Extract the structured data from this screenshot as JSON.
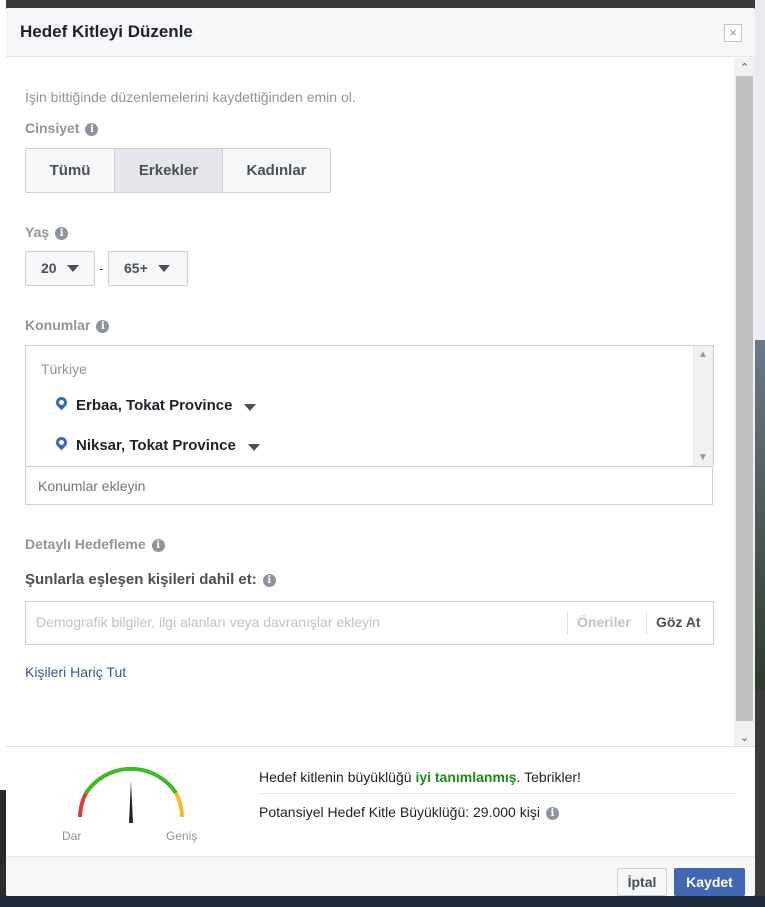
{
  "modal": {
    "title": "Hedef Kitleyi Düzenle",
    "close_icon": "×"
  },
  "hint": "İşin bittiğinde düzenlemelerini kaydettiğinden emin ol.",
  "gender": {
    "label": "Cinsiyet",
    "options": [
      "Tümü",
      "Erkekler",
      "Kadınlar"
    ],
    "selected": "Erkekler"
  },
  "age": {
    "label": "Yaş",
    "min": "20",
    "max": "65+",
    "separator": "-"
  },
  "locations": {
    "label": "Konumlar",
    "country": "Türkiye",
    "items": [
      "Erbaa, Tokat Province",
      "Niksar, Tokat Province"
    ],
    "input_placeholder": "Konumlar ekleyin"
  },
  "detailed_targeting": {
    "label": "Detaylı Hedefleme",
    "include_label": "Şunlarla eşleşen kişileri dahil et:",
    "input_placeholder": "Demografik bilgiler, ilgi alanları veya davranışlar ekleyin",
    "suggestions_label": "Öneriler",
    "browse_label": "Göz At",
    "exclude_link": "Kişileri Hariç Tut"
  },
  "audience": {
    "gauge_low": "Dar",
    "gauge_high": "Geniş",
    "gauge_level": 0.5,
    "message_prefix": "Hedef kitlenin büyüklüğü ",
    "message_status": "iyi tanımlanmış",
    "message_suffix": ". Tebrikler!",
    "size_text": "Potansiyel Hedef Kitle Büyüklüğü: 29.000 kişi",
    "status_color": "#1e8a1e"
  },
  "footer": {
    "cancel_label": "İptal",
    "save_label": "Kaydet"
  },
  "colors": {
    "primary": "#4267b2",
    "link": "#365899",
    "gauge_red": "#e0393e",
    "gauge_green": "#42b72a",
    "gauge_orange": "#f7b928"
  }
}
